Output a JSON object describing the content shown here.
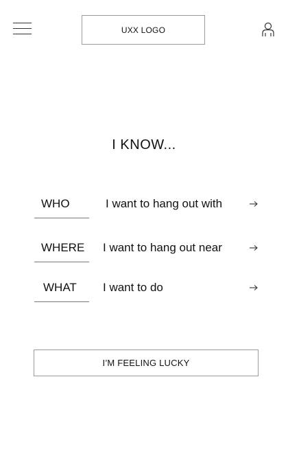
{
  "header": {
    "logo_text": "UXX LOGO",
    "menu_icon": "hamburger-menu-icon",
    "user_icon": "user-profile-icon"
  },
  "main": {
    "title": "I KNOW...",
    "options": [
      {
        "key": "WHO",
        "phrase": "I want to hang out with",
        "icon": "arrow-right-icon"
      },
      {
        "key": "WHERE",
        "phrase": "I want to hang out near",
        "icon": "arrow-right-icon"
      },
      {
        "key": "WHAT",
        "phrase": "I want to do",
        "icon": "arrow-right-icon"
      }
    ],
    "lucky_button_label": "I’M FEELING LUCKY"
  }
}
